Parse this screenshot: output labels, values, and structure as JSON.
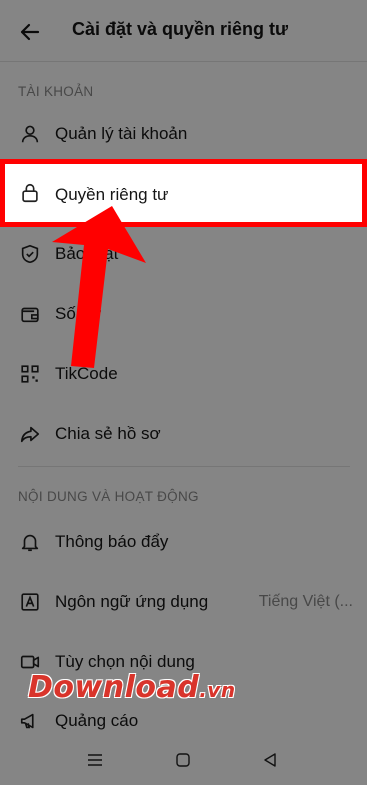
{
  "header": {
    "title": "Cài đặt và quyền riêng tư",
    "back_icon": "arrow-left-icon"
  },
  "sections": {
    "account": {
      "label": "TÀI KHOẢN",
      "items": [
        {
          "icon": "person-icon",
          "label": "Quản lý tài khoản"
        },
        {
          "icon": "lock-icon",
          "label": "Quyền riêng tư"
        },
        {
          "icon": "shield-check-icon",
          "label": "Bảo mật"
        },
        {
          "icon": "wallet-icon",
          "label": "Số dư"
        },
        {
          "icon": "qr-code-icon",
          "label": "TikCode"
        },
        {
          "icon": "share-icon",
          "label": "Chia sẻ hồ sơ"
        }
      ]
    },
    "content": {
      "label": "NỘI DUNG VÀ HOẠT ĐỘNG",
      "items": [
        {
          "icon": "bell-icon",
          "label": "Thông báo đẩy"
        },
        {
          "icon": "language-icon",
          "label": "Ngôn ngữ ứng dụng",
          "value": "Tiếng Việt (..."
        },
        {
          "icon": "video-icon",
          "label": "Tùy chọn nội dung"
        },
        {
          "icon": "megaphone-icon",
          "label": "Quảng cáo"
        }
      ]
    }
  },
  "watermark": {
    "main": "Download",
    "tld": ".vn"
  },
  "colors": {
    "highlight_border": "#ff0000",
    "arrow": "#ff0000",
    "watermark": "#d9342b"
  },
  "navbar": {
    "icons": [
      "menu-icon",
      "home-square-icon",
      "back-triangle-icon"
    ]
  }
}
